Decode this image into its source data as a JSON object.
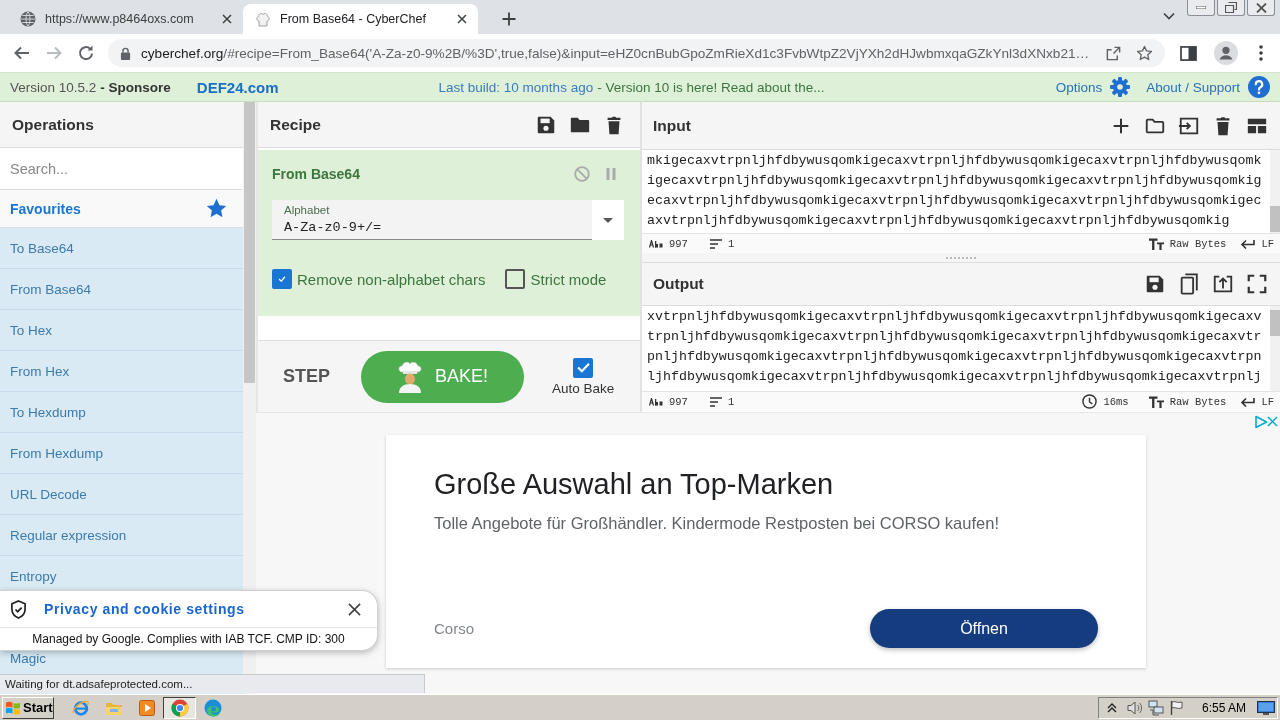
{
  "browser": {
    "tabs": [
      {
        "kind": "globe",
        "title": "https://www.p8464oxs.com",
        "selected": false
      },
      {
        "kind": "chef",
        "title": "From Base64 - CyberChef",
        "selected": true
      }
    ],
    "nav": [
      {
        "kind": "back",
        "disabled": false
      },
      {
        "kind": "forward",
        "disabled": true
      },
      {
        "kind": "reload",
        "disabled": false
      }
    ],
    "address": {
      "host": "cyberchef.org",
      "rest": "/#recipe=From_Base64('A-Za-z0-9%2B/%3D',true,false)&input=eHZ0cnBubGpoZmRieXd1c3FvbWtpZ2VjYXh2dHJwbmxqaGZkYnl3dXNxb21…"
    },
    "status_text": "Waiting for dt.adsafeprotected.com..."
  },
  "banner": {
    "version": "Version 10.5.2",
    "sponsor_prefix": "- Sponsore",
    "sponsor": "DEF24.com",
    "build": "Last build: 10 months ago",
    "notice": "- Version 10 is here! Read about the...",
    "options": "Options",
    "about": "About / Support"
  },
  "operations": {
    "title": "Operations",
    "search": {
      "placeholder": "Search..."
    },
    "favourites": "Favourites",
    "items": [
      "To Base64",
      "From Base64",
      "To Hex",
      "From Hex",
      "To Hexdump",
      "From Hexdump",
      "URL Decode",
      "Regular expression",
      "Entropy"
    ],
    "items_below_popup": [
      "Magic"
    ]
  },
  "recipe": {
    "title": "Recipe",
    "operation": {
      "name": "From Base64",
      "alphabet": {
        "label": "Alphabet",
        "value": "A-Za-z0-9+/="
      },
      "options": [
        {
          "label": "Remove non-alphabet chars",
          "checked": true
        },
        {
          "label": "Strict mode",
          "checked": false
        }
      ]
    },
    "step": "STEP",
    "bake": "BAKE!",
    "auto_bake": {
      "label": "Auto Bake",
      "checked": true
    }
  },
  "input": {
    "title": "Input",
    "lines": [
      "mkigecaxvtrpnljhfdbywusqomkigecaxvtrpnljhfdbywusqomkigecaxvtrpnljhfdbywusqomk",
      "igecaxvtrpnljhfdbywusqomkigecaxvtrpnljhfdbywusqomkigecaxvtrpnljhfdbywusqomkig",
      "ecaxvtrpnljhfdbywusqomkigecaxvtrpnljhfdbywusqomkigecaxvtrpnljhfdbywusqomkigec",
      "axvtrpnljhfdbywusqomkigecaxvtrpnljhfdbywusqomkigecaxvtrpnljhfdbywusqomkig"
    ],
    "length": "997",
    "line_count": "1",
    "encoding": "Raw Bytes",
    "eol": "LF"
  },
  "output": {
    "title": "Output",
    "lines": [
      "xvtrpnljhfdbywusqomkigecaxvtrpnljhfdbywusqomkigecaxvtrpnljhfdbywusqomkigecaxv",
      "trpnljhfdbywusqomkigecaxvtrpnljhfdbywusqomkigecaxvtrpnljhfdbywusqomkigecaxvtr",
      "pnljhfdbywusqomkigecaxvtrpnljhfdbywusqomkigecaxvtrpnljhfdbywusqomkigecaxvtrpn",
      "ljhfdbywusqomkigecaxvtrpnljhfdbywusqomkigecaxvtrpnljhfdbywusqomkigecaxvtrpnlj"
    ],
    "length": "997",
    "line_count": "1",
    "time": "16ms",
    "encoding": "Raw Bytes",
    "eol": "LF"
  },
  "ad": {
    "headline": "Große Auswahl an Top-Marken",
    "text": "Tolle Angebote für Großhändler. Kindermode Restposten bei CORSO kaufen!",
    "advertiser": "Corso",
    "button": "Öffnen"
  },
  "cookie_banner": {
    "title": "Privacy and cookie settings",
    "text": "Managed by Google. Complies with IAB TCF. CMP ID: 300"
  },
  "taskbar": {
    "start": "Start",
    "apps": [
      {
        "kind": "ie",
        "selected": false
      },
      {
        "kind": "explorer",
        "selected": false
      },
      {
        "kind": "media",
        "selected": false
      },
      {
        "kind": "chrome",
        "selected": true
      },
      {
        "kind": "edge",
        "selected": false
      }
    ],
    "clock": "6:55 AM"
  }
}
